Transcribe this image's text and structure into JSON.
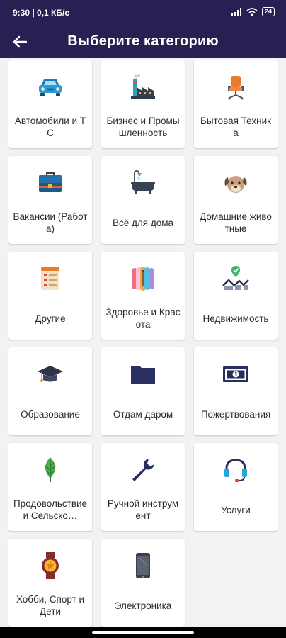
{
  "status_bar": {
    "time_text": "9:30 | 0,1 КБ/с",
    "battery_text": "24"
  },
  "app_bar": {
    "title": "Выберите категорию"
  },
  "categories": [
    {
      "label": "Автомобили и ТС",
      "icon": "car-icon"
    },
    {
      "label": "Бизнес и Промышленность",
      "icon": "factory-icon"
    },
    {
      "label": "Бытовая Техника",
      "icon": "office-chair-icon"
    },
    {
      "label": "Вакансии (Работа)",
      "icon": "briefcase-icon"
    },
    {
      "label": "Всё для дома",
      "icon": "bathtub-icon"
    },
    {
      "label": "Домашние животные",
      "icon": "dog-icon"
    },
    {
      "label": "Другие",
      "icon": "checklist-icon"
    },
    {
      "label": "Здоровье и Красота",
      "icon": "color-palette-icon"
    },
    {
      "label": "Недвижимость",
      "icon": "location-houses-icon"
    },
    {
      "label": "Образование",
      "icon": "graduation-cap-icon"
    },
    {
      "label": "Отдам даром",
      "icon": "folder-icon"
    },
    {
      "label": "Пожертвования",
      "icon": "banknote-icon"
    },
    {
      "label": "Продовольствие и Сельско…",
      "icon": "leaf-icon"
    },
    {
      "label": "Ручной инструмент",
      "icon": "wrench-icon"
    },
    {
      "label": "Услуги",
      "icon": "headset-icon"
    },
    {
      "label": "Хобби, Спорт и Дети",
      "icon": "medal-icon"
    },
    {
      "label": "Электроника",
      "icon": "smartphone-icon"
    }
  ]
}
